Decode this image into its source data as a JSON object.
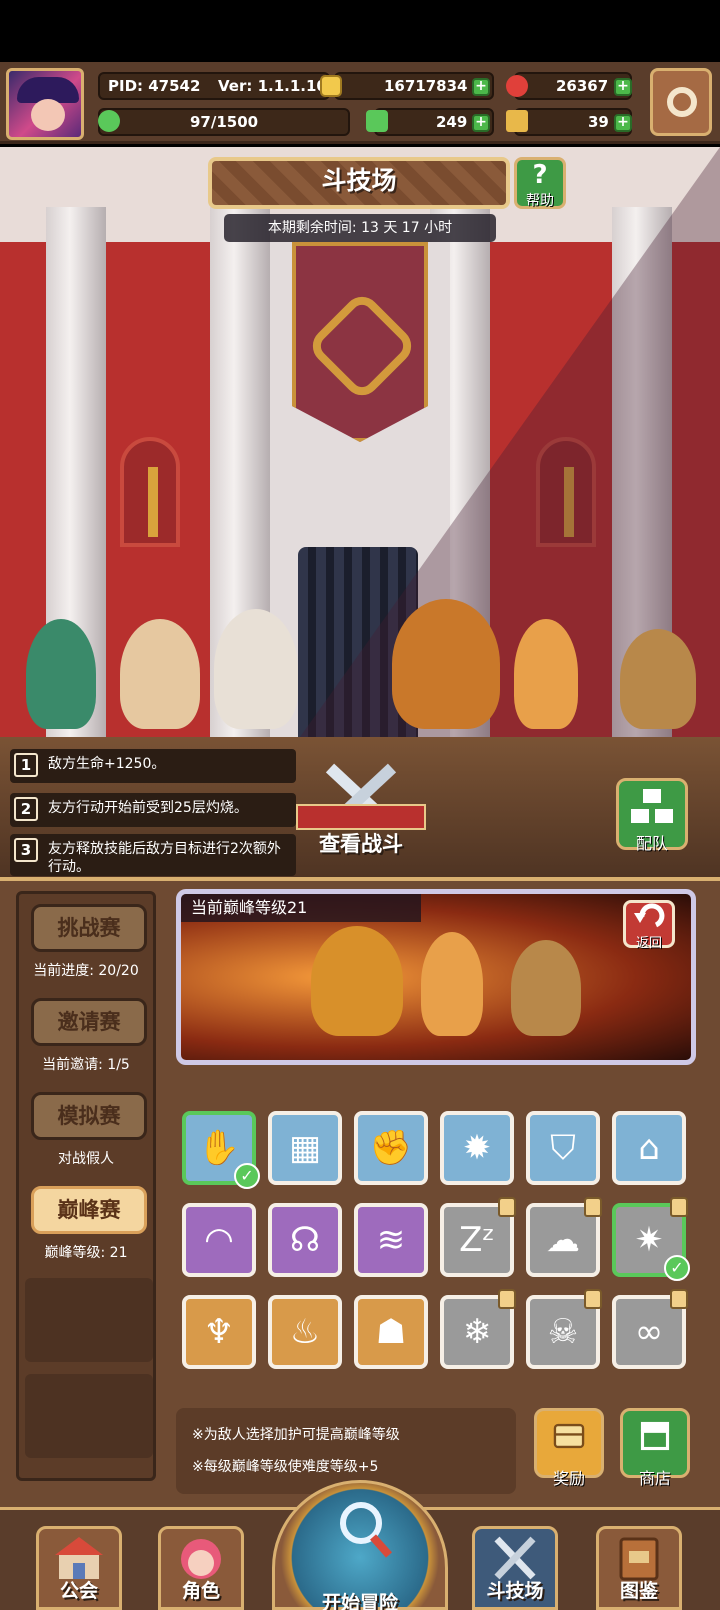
{
  "status_bar": {},
  "player": {
    "pid_label": "PID: 47542",
    "version_label": "Ver: 1.1.1.10",
    "gold": "16717834",
    "gems": "26367",
    "stamina": "97/1500",
    "clover": "249",
    "keys": "39"
  },
  "arena": {
    "title": "斗技场",
    "help_label": "帮助",
    "help_icon": "?",
    "season_remaining": "本期剩余时间: 13 天 17 小时"
  },
  "buffs": [
    {
      "num": "1",
      "text": "敌方生命+1250。"
    },
    {
      "num": "2",
      "text": "友方行动开始前受到25层灼烧。"
    },
    {
      "num": "3",
      "text": "友方释放技能后敌方目标进行2次额外行动。"
    }
  ],
  "actions": {
    "view_battle": "查看战斗",
    "team": "配队"
  },
  "modes": [
    {
      "label": "挑战赛",
      "sub": "当前进度: 20/20",
      "active": false
    },
    {
      "label": "邀请赛",
      "sub": "当前邀请: 1/5",
      "active": false
    },
    {
      "label": "模拟赛",
      "sub": "对战假人",
      "active": false
    },
    {
      "label": "巅峰赛",
      "sub": "巅峰等级: 21",
      "active": true
    }
  ],
  "preview": {
    "title": "当前巅峰等级21",
    "back_label": "返回"
  },
  "blessings": [
    {
      "color": "blue",
      "icon": "hand-icon",
      "glyph": "✋",
      "selected": true,
      "locked": false
    },
    {
      "color": "blue",
      "icon": "brick-wall-icon",
      "glyph": "▦",
      "selected": false,
      "locked": false
    },
    {
      "color": "blue",
      "icon": "claw-icon",
      "glyph": "✊",
      "selected": false,
      "locked": false
    },
    {
      "color": "blue",
      "icon": "sun-icon",
      "glyph": "✹",
      "selected": false,
      "locked": false
    },
    {
      "color": "blue",
      "icon": "shield-icon",
      "glyph": "⛉",
      "selected": false,
      "locked": false
    },
    {
      "color": "blue",
      "icon": "tombstone-icon",
      "glyph": "⌂",
      "selected": false,
      "locked": false
    },
    {
      "color": "purple",
      "icon": "rainbow-icon",
      "glyph": "◠",
      "selected": false,
      "locked": false
    },
    {
      "color": "purple",
      "icon": "ouroboros-icon",
      "glyph": "☊",
      "selected": false,
      "locked": false
    },
    {
      "color": "purple",
      "icon": "wave-icon",
      "glyph": "≋",
      "selected": false,
      "locked": false
    },
    {
      "color": "gray",
      "icon": "sleep-icon",
      "glyph": "Zᶻ",
      "selected": false,
      "locked": true
    },
    {
      "color": "gray",
      "icon": "cloud-icon",
      "glyph": "☁",
      "selected": false,
      "locked": true
    },
    {
      "color": "gray",
      "icon": "burst-icon",
      "glyph": "✷",
      "selected": true,
      "locked": true
    },
    {
      "color": "orange",
      "icon": "torch-icon",
      "glyph": "♆",
      "selected": false,
      "locked": false
    },
    {
      "color": "orange",
      "icon": "fire-icon",
      "glyph": "♨",
      "selected": false,
      "locked": false
    },
    {
      "color": "orange",
      "icon": "ghost-icon",
      "glyph": "☗",
      "selected": false,
      "locked": false
    },
    {
      "color": "gray",
      "icon": "snowflake-icon",
      "glyph": "❄",
      "selected": false,
      "locked": true
    },
    {
      "color": "gray",
      "icon": "skull-icon",
      "glyph": "☠",
      "selected": false,
      "locked": true
    },
    {
      "color": "gray",
      "icon": "infinity-icon",
      "glyph": "∞",
      "selected": false,
      "locked": true
    }
  ],
  "tips": [
    "※为敌人选择加护可提高巅峰等级",
    "※每级巅峰等级使难度等级+5"
  ],
  "panel_buttons": {
    "reward": "奖励",
    "shop": "商店"
  },
  "nav": {
    "guild": "公会",
    "character": "角色",
    "adventure": "开始冒险",
    "arena": "斗技场",
    "codex": "图鉴"
  },
  "colors": {
    "panel": "#6e4a32",
    "accent_gold": "#d9b070",
    "green_button": "#3e9a45",
    "red_wall": "#b8302e"
  }
}
